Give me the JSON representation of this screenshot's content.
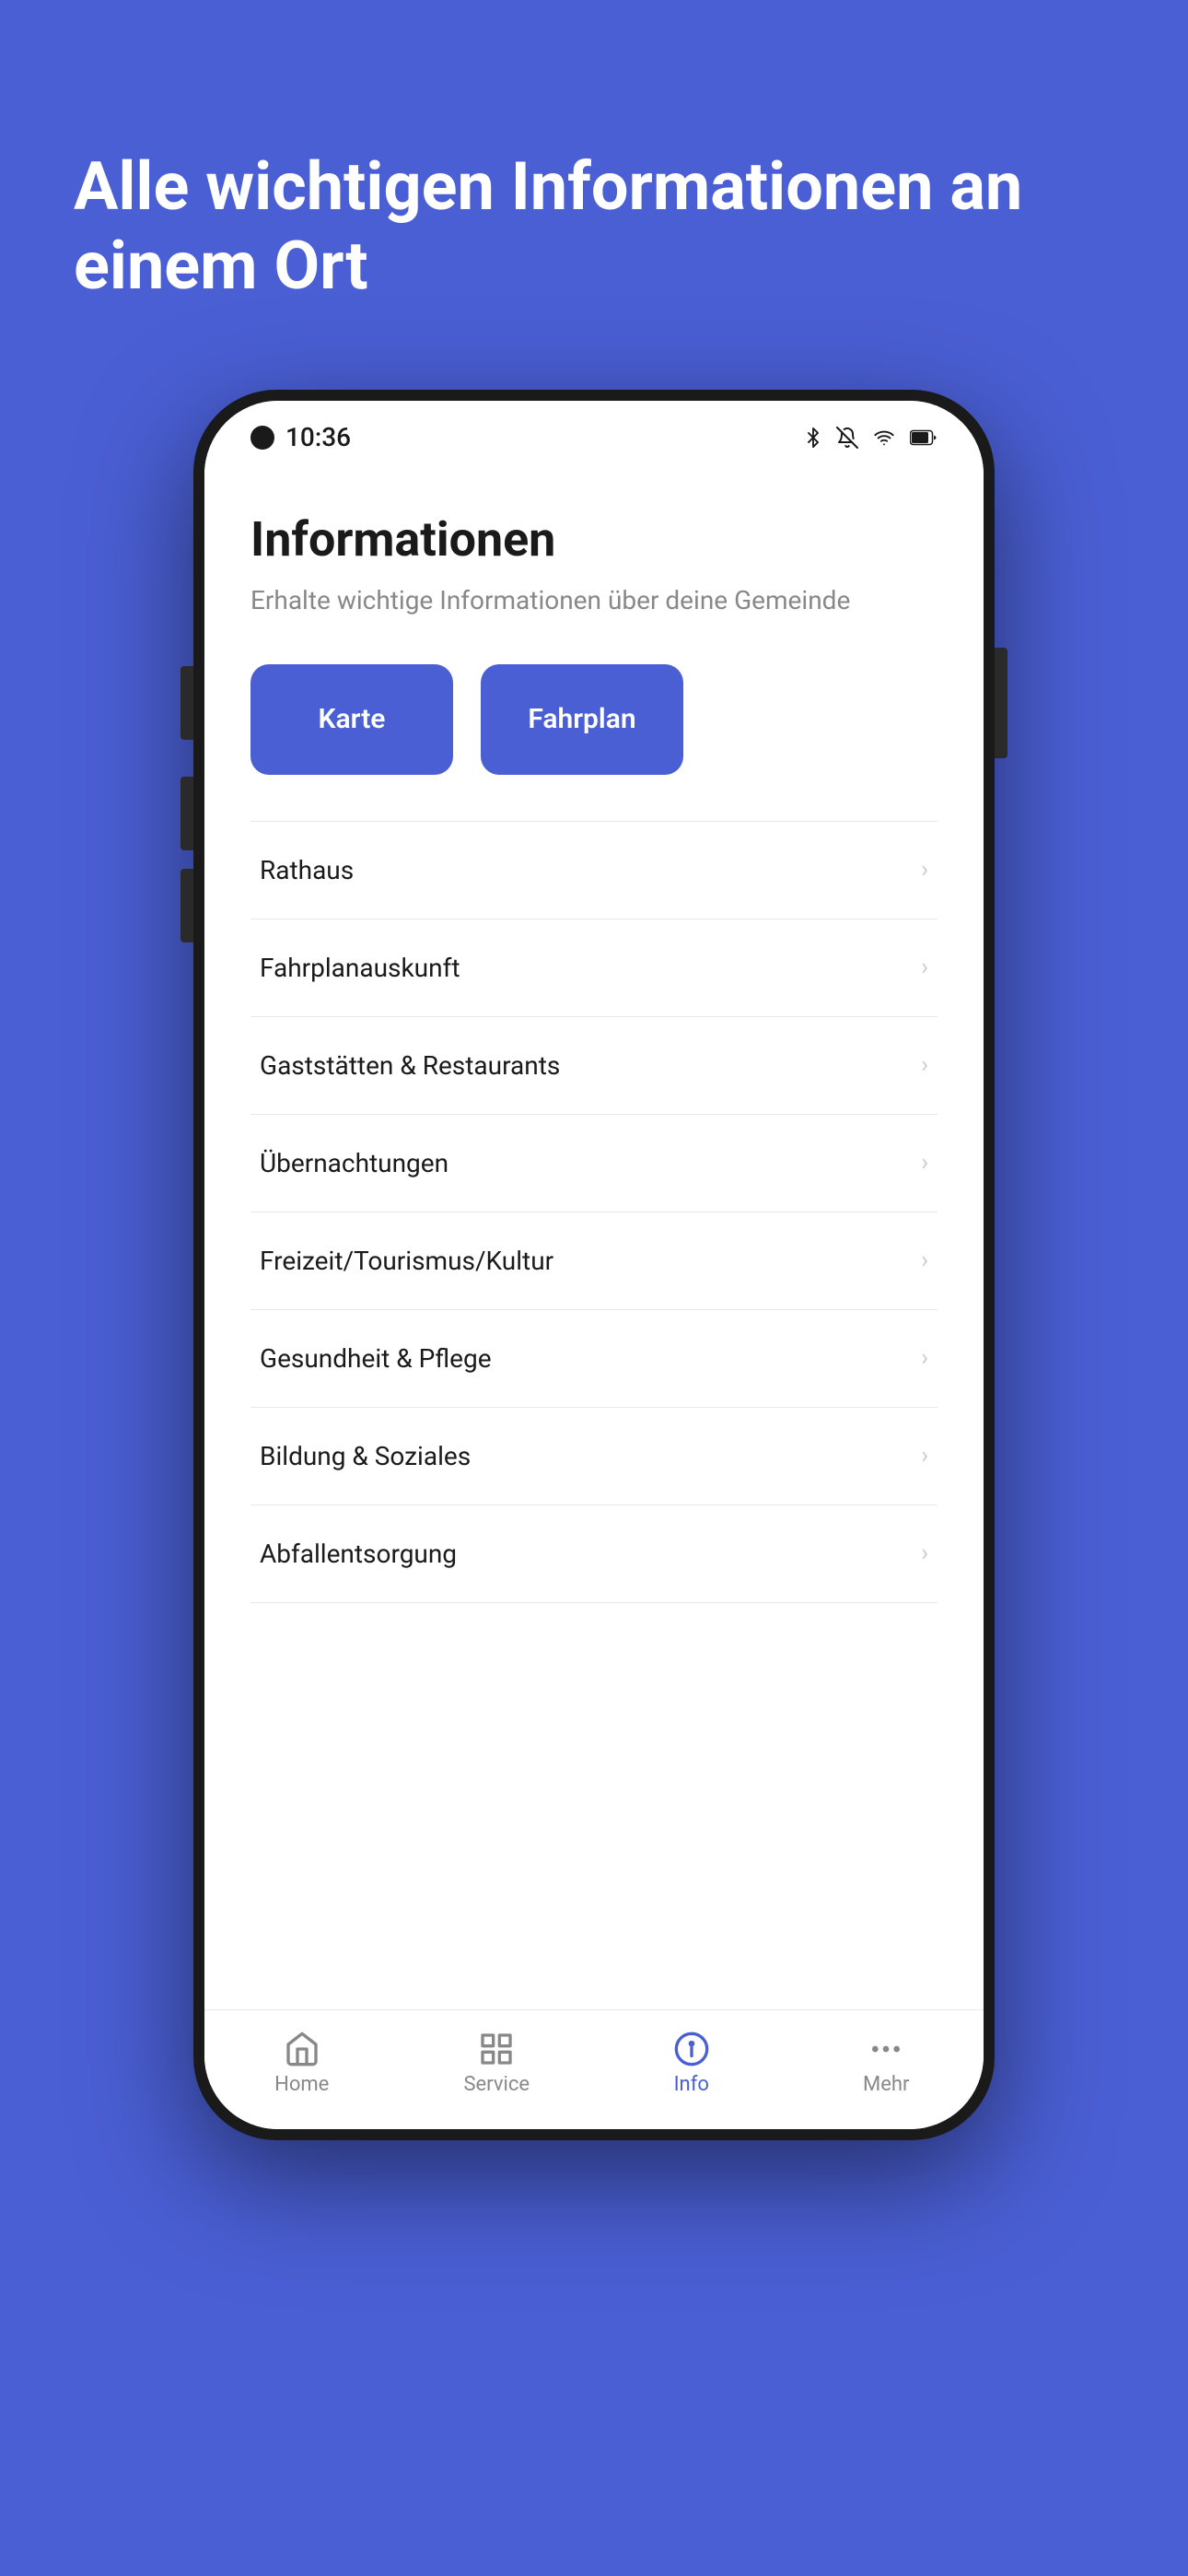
{
  "background_color": "#4a5fd4",
  "hero": {
    "title": "Alle wichtigen Informationen an einem Ort"
  },
  "phone": {
    "status_bar": {
      "time": "10:36",
      "icons": [
        "bluetooth",
        "mute",
        "wifi",
        "battery"
      ]
    },
    "app": {
      "page_title": "Informationen",
      "page_subtitle": "Erhalte wichtige Informationen über deine Gemeinde",
      "quick_actions": [
        {
          "label": "Karte",
          "id": "karte"
        },
        {
          "label": "Fahrplan",
          "id": "fahrplan"
        }
      ],
      "menu_items": [
        {
          "label": "Rathaus",
          "id": "rathaus"
        },
        {
          "label": "Fahrplanauskunft",
          "id": "fahrplanauskunft"
        },
        {
          "label": "Gaststätten & Restaurants",
          "id": "gaststaetten"
        },
        {
          "label": "Übernachtungen",
          "id": "uebernachtungen"
        },
        {
          "label": "Freizeit/Tourismus/Kultur",
          "id": "freizeit"
        },
        {
          "label": "Gesundheit & Pflege",
          "id": "gesundheit"
        },
        {
          "label": "Bildung & Soziales",
          "id": "bildung"
        },
        {
          "label": "Abfallentsorgung",
          "id": "abfallentsorgung"
        }
      ]
    },
    "bottom_nav": [
      {
        "label": "Home",
        "icon": "home",
        "active": false,
        "id": "home"
      },
      {
        "label": "Service",
        "icon": "grid",
        "active": false,
        "id": "service"
      },
      {
        "label": "Info",
        "icon": "info-circle",
        "active": true,
        "id": "info"
      },
      {
        "label": "Mehr",
        "icon": "more",
        "active": false,
        "id": "mehr"
      }
    ]
  }
}
